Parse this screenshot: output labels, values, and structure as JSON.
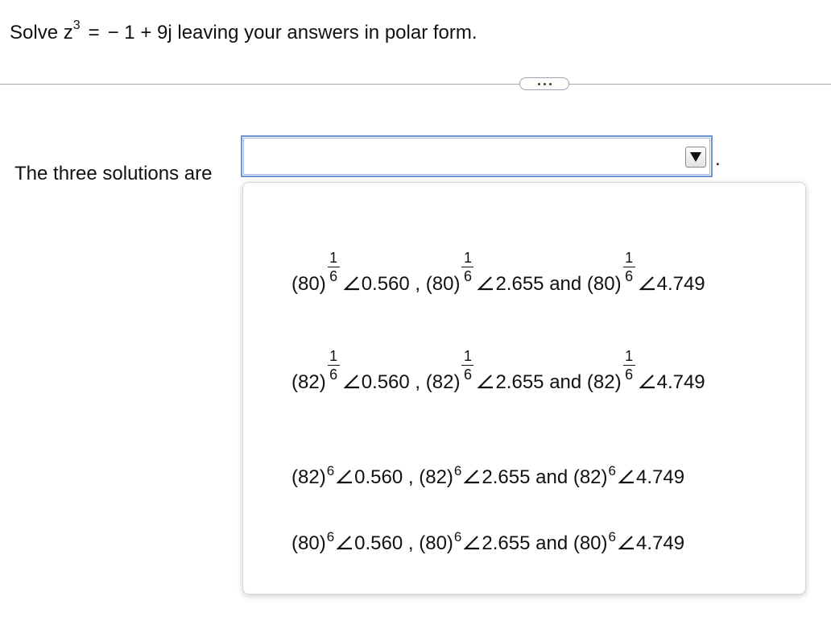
{
  "question": {
    "prefix": "Solve z",
    "exponent": "3",
    "equals": "=",
    "rhs_and_instruction": "− 1 + 9j leaving your answers in polar form."
  },
  "answer": {
    "label": "The three solutions are",
    "selected_value": "",
    "trailing": "."
  },
  "icons": {
    "dropdown": "dropdown-triangle-icon",
    "angle": "angle-icon",
    "more": "ellipsis-icon"
  },
  "options": [
    {
      "style": "fractional-exponent",
      "base": "(80)",
      "exp_num": "1",
      "exp_den": "6",
      "angles": [
        "0.560",
        "2.655",
        "4.749"
      ],
      "sep1": ",",
      "sep2": "and"
    },
    {
      "style": "fractional-exponent",
      "base": "(82)",
      "exp_num": "1",
      "exp_den": "6",
      "angles": [
        "0.560",
        "2.655",
        "4.749"
      ],
      "sep1": ",",
      "sep2": "and"
    },
    {
      "style": "integer-exponent",
      "base": "(82)",
      "exp": "6",
      "angles": [
        "0.560",
        "2.655",
        "4.749"
      ],
      "sep1": ",",
      "sep2": "and"
    },
    {
      "style": "integer-exponent",
      "base": "(80)",
      "exp": "6",
      "angles": [
        "0.560",
        "2.655",
        "4.749"
      ],
      "sep1": ",",
      "sep2": "and"
    }
  ],
  "colors": {
    "dropdown_border": "#6b94d6",
    "divider": "#a8a8a8",
    "text": "#111111"
  }
}
